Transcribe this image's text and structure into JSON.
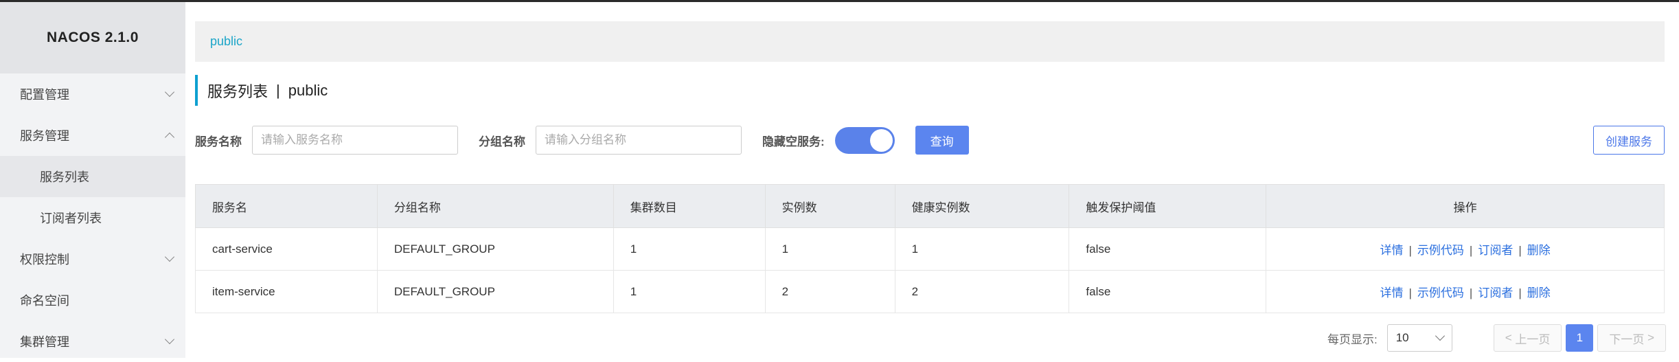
{
  "brand": "NACOS 2.1.0",
  "sidebar": {
    "items": [
      {
        "label": "配置管理"
      },
      {
        "label": "服务管理"
      },
      {
        "label": "服务列表"
      },
      {
        "label": "订阅者列表"
      },
      {
        "label": "权限控制"
      },
      {
        "label": "命名空间"
      },
      {
        "label": "集群管理"
      }
    ]
  },
  "breadcrumb": "public",
  "page": {
    "title": "服务列表",
    "separator": "|",
    "namespace": "public"
  },
  "filters": {
    "service_label": "服务名称",
    "service_placeholder": "请输入服务名称",
    "group_label": "分组名称",
    "group_placeholder": "请输入分组名称",
    "hide_empty_label": "隐藏空服务:",
    "hide_empty_on": true,
    "query_label": "查询",
    "create_label": "创建服务"
  },
  "table": {
    "headers": [
      "服务名",
      "分组名称",
      "集群数目",
      "实例数",
      "健康实例数",
      "触发保护阈值",
      "操作"
    ],
    "rows": [
      [
        "cart-service",
        "DEFAULT_GROUP",
        "1",
        "1",
        "1",
        "false"
      ],
      [
        "item-service",
        "DEFAULT_GROUP",
        "1",
        "2",
        "2",
        "false"
      ]
    ],
    "actions": [
      "详情",
      "示例代码",
      "订阅者",
      "删除"
    ],
    "action_sep": "|"
  },
  "pager": {
    "page_size_label": "每页显示:",
    "page_size": "10",
    "prev_label": "上一页",
    "next_label": "下一页",
    "current_page": "1"
  }
}
